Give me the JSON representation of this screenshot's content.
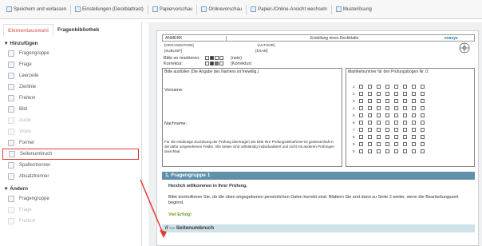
{
  "toolbar": {
    "items": [
      {
        "label": "Speichern und verlassen",
        "icon": "save-icon"
      },
      {
        "label": "Einstellungen (Deckblattrast)",
        "icon": "settings-icon"
      },
      {
        "label": "Papiervorschau",
        "icon": "paper-preview-icon"
      },
      {
        "label": "Onlinevorschau",
        "icon": "online-preview-icon"
      },
      {
        "label": "Papier-/Online-Ansicht wechseln",
        "icon": "switch-view-icon"
      },
      {
        "label": "Musterlösung",
        "icon": "solution-icon"
      }
    ]
  },
  "sidebar": {
    "tabs": {
      "active": "Elementauswahl",
      "inactive": "Fragenbibliothek"
    },
    "groups": [
      {
        "title": "Hinzufügen",
        "items": [
          {
            "label": "Fragengruppe",
            "icon": "question-group-icon",
            "disabled": false
          },
          {
            "label": "Frage",
            "icon": "question-icon",
            "disabled": false
          },
          {
            "label": "Leerzeile",
            "icon": "blank-line-icon",
            "disabled": false
          },
          {
            "label": "Zierlinie",
            "icon": "ornament-line-icon",
            "disabled": false
          },
          {
            "label": "Freitext",
            "icon": "free-text-icon",
            "disabled": false
          },
          {
            "label": "Bild",
            "icon": "image-icon",
            "disabled": false
          },
          {
            "label": "Audio",
            "icon": "audio-icon",
            "disabled": true
          },
          {
            "label": "Video",
            "icon": "video-icon",
            "disabled": true
          },
          {
            "label": "Formel",
            "icon": "formula-icon",
            "disabled": false
          },
          {
            "label": "Seitenumbruch",
            "icon": "page-break-icon",
            "disabled": false,
            "highlight": true
          },
          {
            "label": "Spaltentrenner",
            "icon": "column-separator-icon",
            "disabled": false
          },
          {
            "label": "Absatztrenner",
            "icon": "paragraph-separator-icon",
            "disabled": false
          }
        ]
      },
      {
        "title": "Ändern",
        "items": [
          {
            "label": "Fragengruppe",
            "icon": "question-group-icon",
            "disabled": false
          },
          {
            "label": "Frage",
            "icon": "question-icon",
            "disabled": true
          },
          {
            "label": "Freitext",
            "icon": "free-text-icon",
            "disabled": true
          }
        ]
      }
    ]
  },
  "document": {
    "header": {
      "left": "ANMERK",
      "center": "Erstellung eines Deckblatts",
      "brand": "evasys",
      "organisation": "[ORGANISATION]",
      "author": "[AUTHOR]",
      "subunit": "[SUBUNIT]",
      "exam": "[EXAM]"
    },
    "marking_hint": "Bitte so markieren:",
    "correction_hint": "Korrektur:",
    "marking_note": "(nein)",
    "correction_note": "(Korrektur)",
    "form_title": "Bitte ausfüllen (Die Angabe des Namens ist freiwillig.)",
    "firstname_label": "Vorname:",
    "lastname_label": "Nachname:",
    "notice": "Für die eindeutige Zuordnung der Prüfung übertragen Sie bitte Ihre Prüfungsteilnehmer-ID gewissenhaft in die dafür vorgesehenen Felder. Alle Seiten sind vollständig individualisiert und nicht mit anderen Prüfungen tauschbar.",
    "matrikel_label": "Matrikelnummer für den Prüfungsbogen Nr. 0:",
    "digits": [
      "1",
      "2",
      "3",
      "4",
      "5",
      "6",
      "7",
      "8",
      "9",
      "0"
    ],
    "section1": "1. Fragengruppe 1",
    "welcome": "Herzlich willkommen in Ihrer Prüfung.",
    "instructions": "Bitte kontrollieren Sie, ob die oben angegebenen persönlichen Daten korrekt sind. Blättern Sie erst dann zu Seite 2 weiter, wenn die Bearbeitungszeit beginnt.",
    "good_luck": "Viel Erfolg!",
    "page_break_bar": "// — Seitenumbruch"
  }
}
